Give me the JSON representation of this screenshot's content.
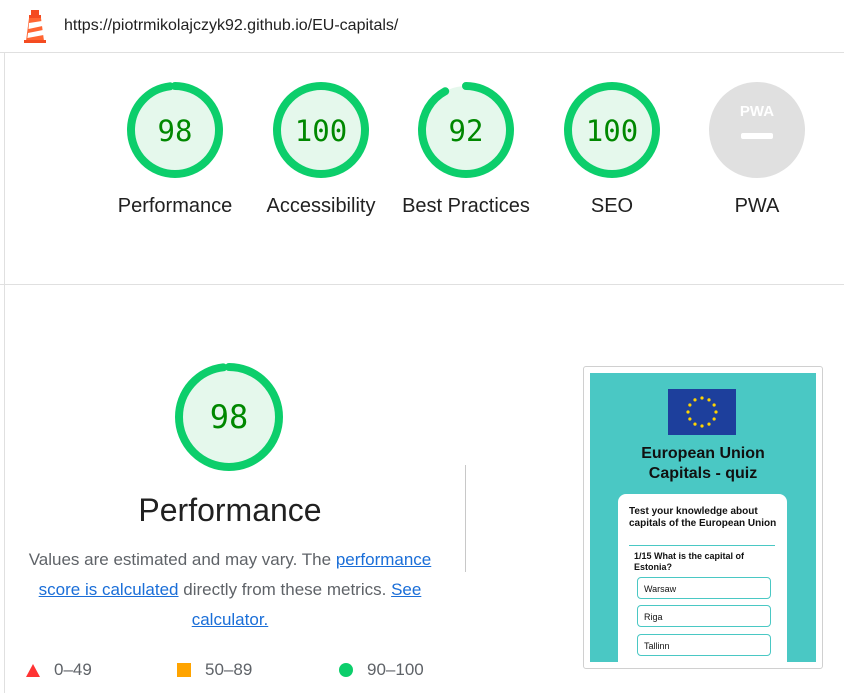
{
  "header": {
    "url": "https://piotrmikolajczyk92.github.io/EU-capitals/"
  },
  "colors": {
    "pass": "#0cce6b",
    "pass_text": "#008800",
    "pass_bg": "#e5f8ec",
    "average": "#ffa400",
    "fail": "#ff3333",
    "na": "#e0e0e0",
    "teal": "#4ac8c4"
  },
  "gauges": [
    {
      "label": "Performance",
      "score": "98",
      "value": 0.98
    },
    {
      "label": "Accessibility",
      "score": "100",
      "value": 1.0
    },
    {
      "label": "Best Practices",
      "score": "92",
      "value": 0.92
    },
    {
      "label": "SEO",
      "score": "100",
      "value": 1.0
    },
    {
      "label": "PWA",
      "badge": "PWA"
    }
  ],
  "performance": {
    "score": "98",
    "value": 0.98,
    "title": "Performance",
    "desc_1": "Values are estimated and may vary. The ",
    "link_1": "performance score is calculated",
    "desc_2": " directly from these metrics. ",
    "link_2": "See calculator."
  },
  "legend": {
    "fail": "0–49",
    "average": "50–89",
    "pass": "90–100"
  },
  "screenshot": {
    "title_line1": "European Union",
    "title_line2": "Capitals - quiz",
    "intro": "Test your knowledge about capitals of the European Union",
    "question": "1/15 What is the capital of Estonia?",
    "answers": [
      "Warsaw",
      "Riga",
      "Tallinn"
    ]
  }
}
